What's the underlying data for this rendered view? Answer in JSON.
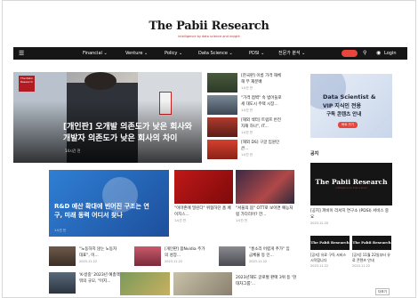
{
  "site": {
    "logo": "The Pabii Research",
    "tagline": "intelligence by data science and insight"
  },
  "nav": {
    "menu_icon": "☰",
    "items": [
      "Financial ⌄",
      "Venture ⌄",
      "Policy ⌄",
      "Data Science ⌄",
      "PDSI ⌄",
      "전문가 분석 ⌄"
    ],
    "search_icon": "⚲",
    "user_icon": "◉",
    "login": "Login"
  },
  "hero": {
    "badge": "The Pabii Research",
    "title": "[개인판] 오개발 의존도가 낮은 회사와 개발자 의존도가 낮은 회사의 차이",
    "date": "14시간 전"
  },
  "side_news": [
    {
      "title": "[한국판] 이름 가격 해체해 부 재분배",
      "date": "1시간 전"
    },
    {
      "title": "\"가격 점벽\" 속 범어들로 세 대도시 주택 시장...",
      "date": "1시간 전"
    },
    {
      "title": "[해외 섹터] 트럼프 반전자재 하나\", IT...",
      "date": "1시간 전"
    },
    {
      "title": "[해외 DS] 구글 임원인큰...",
      "date": "1시간 전"
    }
  ],
  "rd_card": {
    "title": "R&D 예산 확대에 빈어진 구조는 연구, 미래 동력 어디서 찾나",
    "date": "1시간 전"
  },
  "mid_cards": [
    {
      "title": "\"이마존에 밀린다\" 위협하던 홈 페이지스...",
      "date": "1시간 전"
    },
    {
      "title": "\"서울의 봄\" OTT로 보이면 예능처럼 가다리어? 한...",
      "date": "1시간 전"
    }
  ],
  "bottom_news": [
    {
      "title": "\"노동하지 않는 노동자 대표\", 이...",
      "date": "2023.11.22"
    },
    {
      "title": "[개인판] 몸Nvidia 주가의 성장...",
      "date": "2023.11.22"
    },
    {
      "title": "\"홍소리 어렵게 추가\" 임금체불 등 인...",
      "date": "2023.11.22"
    }
  ],
  "bottom_row2": [
    {
      "title": "'K-방중' 2023년 예총액 뭐의 규모, \"이지..."
    },
    {
      "title": "2023년해도 글로벌 판매 3위 등 '현대차그룹'..."
    }
  ],
  "ad": {
    "line1": "Data Scientist &",
    "line2": "VIP 지식인 전용",
    "line3": "구독 콘텐츠 안내",
    "button": "바로 가기"
  },
  "notice": {
    "heading": "공지",
    "logo": "The Pabii Research",
    "sublogo": "intelligence by data science",
    "main_title": "[공지] 파비이 리서치 연구소 (PDSI) 서비스 중요",
    "main_date": "2023.12.20",
    "small_logo": "The Pabii Research",
    "small_items": [
      {
        "title": "[공지] 유료 구독 서비스 시작합니다",
        "date": "2023.11.22"
      },
      {
        "title": "[공지] 11월 22일부터 유료 콘텐츠 안내",
        "date": "2023.11.22"
      }
    ],
    "more": "더보기"
  }
}
